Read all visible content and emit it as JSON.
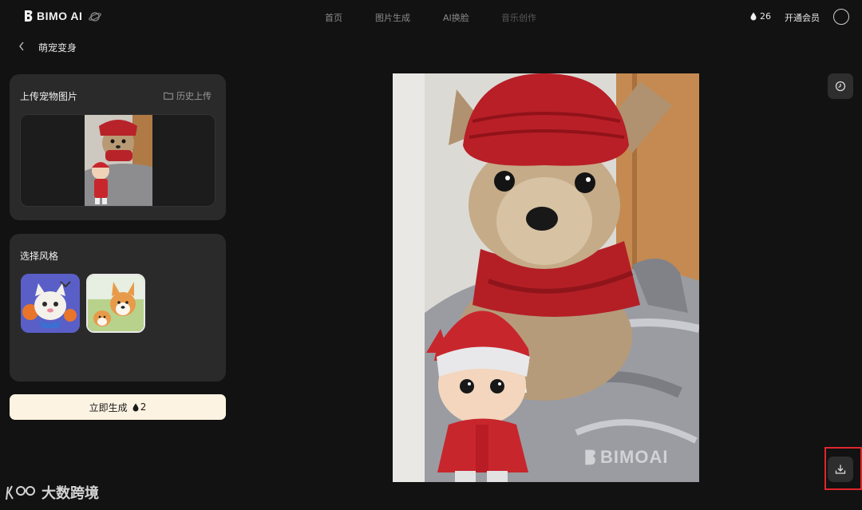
{
  "app": {
    "logo_text": "BIMO AI"
  },
  "nav": {
    "items": [
      "首页",
      "图片生成",
      "AI换脸",
      "音乐创作"
    ]
  },
  "account": {
    "credits": "26",
    "vip_label": "开通会员"
  },
  "page": {
    "title": "萌宠变身"
  },
  "upload_panel": {
    "heading": "上传宠物图片",
    "history_label": "历史上传"
  },
  "style_panel": {
    "heading": "选择风格",
    "selected_index": 1
  },
  "generate": {
    "label": "立即生成",
    "cost": "2"
  },
  "result": {
    "watermark": "BIMOAI"
  },
  "overlay": {
    "corner_text": "大数跨境"
  },
  "colors": {
    "background": "#121212",
    "panel": "#2a2a2a",
    "button_bg": "#fdf3e2",
    "highlight": "#e0262b"
  }
}
